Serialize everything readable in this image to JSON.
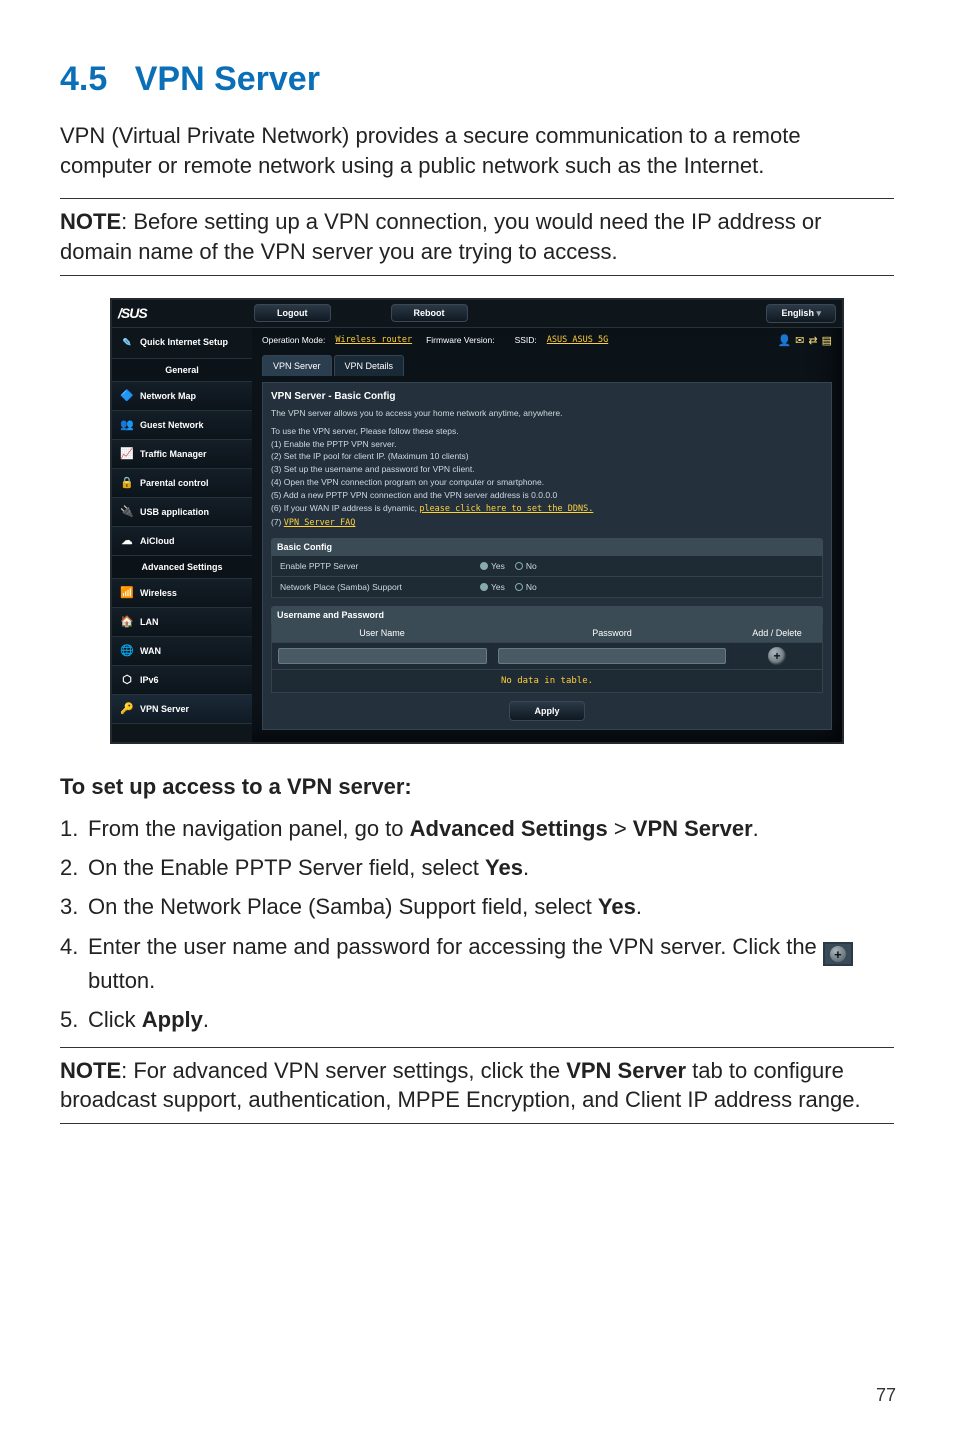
{
  "heading": {
    "num": "4.5",
    "title": "VPN Server"
  },
  "intro": "VPN (Virtual Private Network) provides a secure communication to a remote computer or remote network using a public network such as the Internet.",
  "note1": {
    "label": "NOTE",
    "text": ":  Before setting up a VPN connection, you would need the IP address or domain name of the VPN server you are trying to access."
  },
  "shot": {
    "brand": "/SUS",
    "top": {
      "logout": "Logout",
      "reboot": "Reboot",
      "lang": "English"
    },
    "status": {
      "opmode_label": "Operation Mode:",
      "opmode_value": "Wireless router",
      "fw_label": "Firmware Version:",
      "ssid_label": "SSID:",
      "ssid_value": "ASUS  ASUS_5G"
    },
    "sidebar": {
      "qis": "Quick Internet Setup",
      "general": "General",
      "advanced": "Advanced Settings",
      "items_general": [
        {
          "icon": "🔷",
          "label": "Network Map",
          "cls": "c-blue"
        },
        {
          "icon": "👥",
          "label": "Guest Network",
          "cls": "c-org"
        },
        {
          "icon": "📈",
          "label": "Traffic Manager",
          "cls": "c-grn"
        },
        {
          "icon": "🔒",
          "label": "Parental control",
          "cls": "c-org2"
        },
        {
          "icon": "🔌",
          "label": "USB application",
          "cls": "c-red"
        },
        {
          "icon": "☁",
          "label": "AiCloud",
          "cls": "c-blu2"
        }
      ],
      "items_adv": [
        {
          "icon": "📶",
          "label": "Wireless"
        },
        {
          "icon": "🏠",
          "label": "LAN"
        },
        {
          "icon": "🌐",
          "label": "WAN"
        },
        {
          "icon": "⬡",
          "label": "IPv6"
        },
        {
          "icon": "🔑",
          "label": "VPN Server"
        }
      ]
    },
    "tabs": {
      "a": "VPN Server",
      "b": "VPN Details"
    },
    "panel_title": "VPN Server - Basic Config",
    "desc": "The VPN server allows you to access your home network anytime, anywhere.",
    "steps_intro": "To use the VPN server, Please follow these steps.",
    "steps": [
      "(1) Enable the PPTP VPN server.",
      "(2) Set the IP pool for client IP. (Maximum 10 clients)",
      "(3) Set up the username and password for VPN client.",
      "(4) Open the VPN connection program on your computer or smartphone.",
      "(5) Add a new PPTP VPN connection and the VPN server address is 0.0.0.0"
    ],
    "step6a": "(6) If your WAN IP address is dynamic, ",
    "step6b": "please click here to set the DDNS.",
    "step7a": "(7) ",
    "step7b": "VPN Server FAQ",
    "basic_config_hdr": "Basic Config",
    "rows": [
      {
        "label": "Enable PPTP Server",
        "yes": "Yes",
        "no": "No"
      },
      {
        "label": "Network Place (Samba) Support",
        "yes": "Yes",
        "no": "No"
      }
    ],
    "userpass_hdr": "Username and Password",
    "cols": {
      "user": "User Name",
      "pass": "Password",
      "action": "Add / Delete"
    },
    "nodata": "No data in table.",
    "apply": "Apply"
  },
  "sub_head": "To set up access to a VPN server:",
  "instructions": [
    {
      "n": "1.",
      "pre": "From the navigation panel, go to ",
      "b1": "Advanced Settings",
      "mid": " > ",
      "b2": "VPN Server",
      "post": "."
    },
    {
      "n": "2.",
      "pre": "On the Enable PPTP Server field, select ",
      "b1": "Yes",
      "post": "."
    },
    {
      "n": "3.",
      "pre": "On the Network Place (Samba) Support field, select ",
      "b1": "Yes",
      "post": "."
    },
    {
      "n": "4.",
      "pre": "Enter the user name and password for accessing the VPN server. Click the ",
      "post": " button.",
      "icon": true
    },
    {
      "n": "5.",
      "pre": "Click ",
      "b1": "Apply",
      "post": "."
    }
  ],
  "note2": {
    "label": "NOTE",
    "text_a": ":  For advanced VPN server settings, click the ",
    "bold": "VPN Server",
    "text_b": " tab to configure broadcast support, authentication, MPPE Encryption, and Client IP address range."
  },
  "pagenum": "77"
}
